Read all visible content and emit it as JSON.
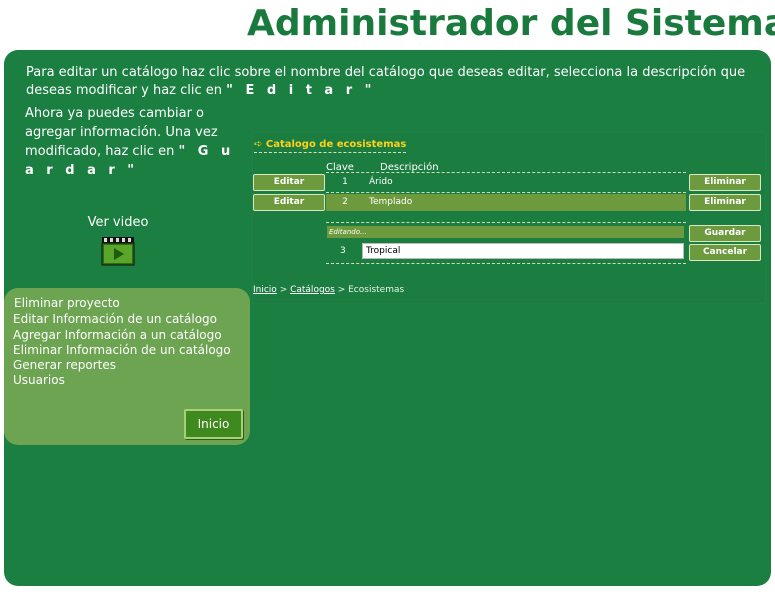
{
  "header": {
    "title": "Administrador del Sistema"
  },
  "instructions": {
    "line1": "Para editar un catálogo haz clic sobre el nombre del catálogo que deseas editar, selecciona la descripción que deseas modificar y haz clic en",
    "editar": "\" E d i t a r \"",
    "line2": "Ahora ya puedes cambiar o agregar información. Una vez modificado, haz clic en",
    "guardar": "\" G u a r d a r \""
  },
  "video": {
    "label": "Ver video",
    "icon": "clapperboard-icon"
  },
  "menu": {
    "items": [
      "Eliminar proyecto",
      "Editar Información de un catálogo",
      "Agregar Información a un catálogo",
      "Eliminar Información de un catálogo",
      "Generar reportes",
      "Usuarios"
    ],
    "inicio_label": "Inicio"
  },
  "demo": {
    "catalog_title": "Catalogo de ecosistemas",
    "arrow_icon": "arrow-right-icon",
    "col_clave": "Clave",
    "col_descripcion": "Descripción",
    "rows": [
      {
        "clave": "1",
        "descripcion": "Árido",
        "edit_label": "Editar",
        "delete_label": "Eliminar"
      },
      {
        "clave": "2",
        "descripcion": "Templado",
        "edit_label": "Editar",
        "delete_label": "Eliminar"
      }
    ],
    "editing_label": "Editando...",
    "edit_row": {
      "clave": "3",
      "value": "Tropical"
    },
    "guardar_label": "Guardar",
    "cancelar_label": "Cancelar",
    "breadcrumb": {
      "inicio": "Inicio",
      "sep": " > ",
      "catalogos": "Catálogos",
      "current": "Ecosistemas"
    }
  },
  "colors": {
    "brand_green": "#1a7a3e",
    "panel_green": "#1b7f42",
    "menu_green": "#6da452",
    "highlight_yellow": "#ffd21a"
  }
}
